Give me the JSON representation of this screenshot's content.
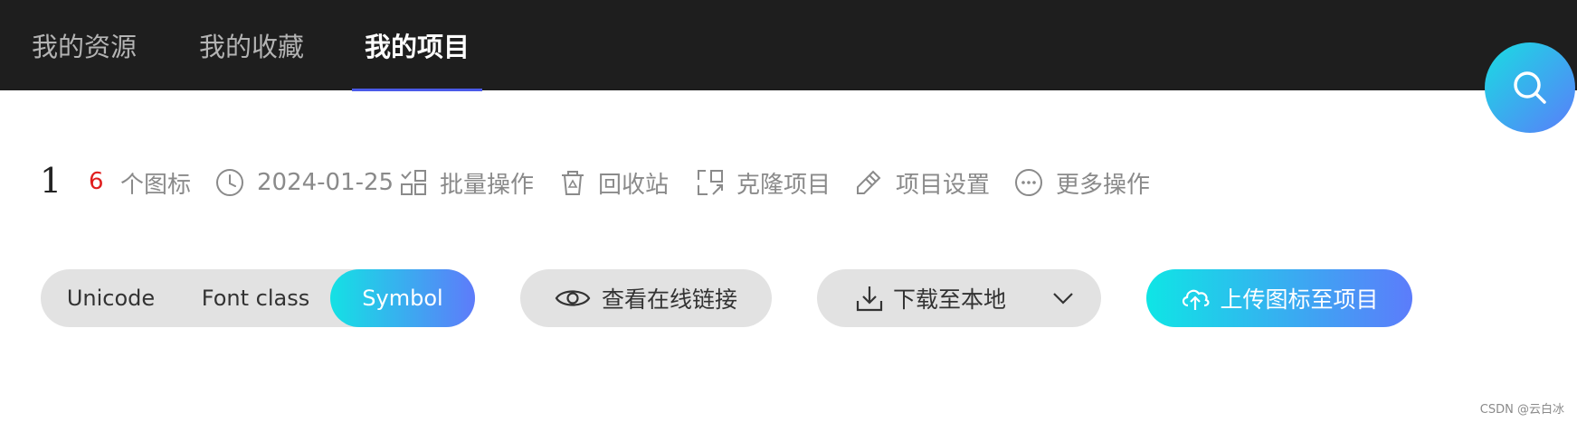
{
  "tabs": [
    {
      "label": "我的资源"
    },
    {
      "label": "我的收藏"
    },
    {
      "label": "我的项目"
    }
  ],
  "search": {
    "icon": "search-icon"
  },
  "stats": {
    "count_big": "1",
    "icon_count": "6",
    "icon_count_suffix": "个图标",
    "date": "2024-01-25"
  },
  "actions": {
    "batch": "批量操作",
    "recycle": "回收站",
    "clone": "克隆项目",
    "settings": "项目设置",
    "more": "更多操作"
  },
  "format_tabs": {
    "items": [
      "Unicode",
      "Font class",
      "Symbol"
    ],
    "selected": "Symbol"
  },
  "buttons": {
    "view_online": "查看在线链接",
    "download": "下载至本地",
    "upload": "上传图标至项目"
  },
  "colors": {
    "topbar_bg": "#1e1e1e",
    "accent_underline": "#4a5ae8",
    "gradient_start": "#14e1e4",
    "gradient_end": "#5e7bfa",
    "count_red": "#e01e1e"
  },
  "watermark": "CSDN @云白冰"
}
